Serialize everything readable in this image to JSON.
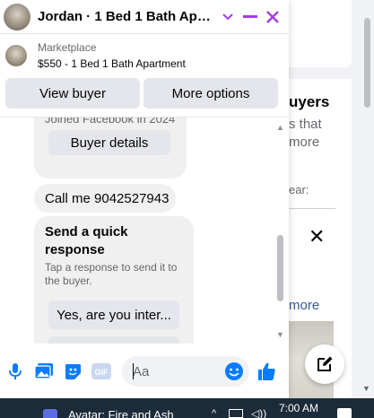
{
  "background": {
    "section_title": "uyers",
    "line1": "s that",
    "line2": "more",
    "line3": "ear:",
    "see_more": "more"
  },
  "chat": {
    "title": "Jordan · 1 Bed 1 Bath Apart...",
    "listing": {
      "source": "Marketplace",
      "summary": "$550 - 1 Bed 1 Bath Apartment"
    },
    "actions": {
      "view_buyer": "View buyer",
      "more_options": "More options"
    },
    "messages": {
      "joined": "Joined Facebook in 2024",
      "buyer_details": "Buyer details",
      "call_me": "Call me 9042527943",
      "quick_title": "Send a quick response",
      "quick_sub": "Tap a response to send it to the buyer.",
      "quick_option_1": "Yes, are you inter..."
    },
    "composer": {
      "placeholder": "Aa"
    }
  },
  "taskbar": {
    "app_title": "Avatar: Fire and Ash",
    "time": "7:00 AM"
  },
  "colors": {
    "accent": "#a33ce8",
    "messenger_blue": "#0a7cff"
  }
}
